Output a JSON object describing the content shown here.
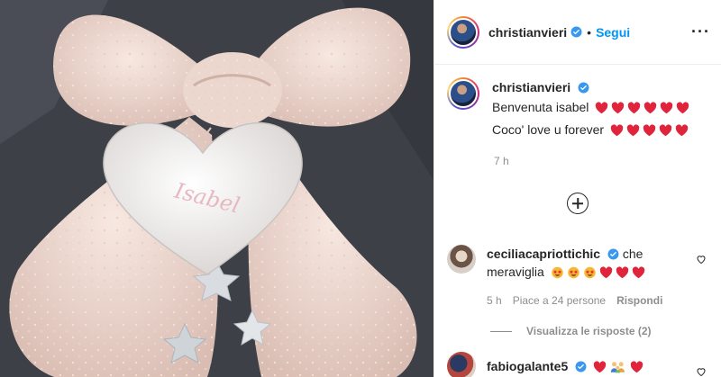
{
  "post": {
    "username": "christianvieri",
    "dot": "•",
    "follow_label": "Segui",
    "more_label": "···",
    "caption_line1": "Benvenuta isabel",
    "caption_line2": "Coco' love u forever",
    "caption_line1_hearts": 6,
    "caption_line2_hearts": 5,
    "time": "7 h"
  },
  "comments": [
    {
      "username": "ceciliacapriottichic",
      "text": "che meraviglia",
      "emojis": [
        "star-struck",
        "star-struck",
        "star-struck",
        "red-heart",
        "red-heart",
        "red-heart"
      ],
      "time": "5 h",
      "likes": "Piace a 24 persone",
      "reply_label": "Rispondi",
      "view_replies": "Visualizza le risposte (2)"
    },
    {
      "username": "fabiogalante5",
      "emojis": [
        "red-heart",
        "family",
        "red-heart"
      ]
    }
  ],
  "photo": {
    "nameplate_text": "Isabel"
  },
  "colors": {
    "accent": "#0095f6",
    "verified": "#3897f0",
    "heart": "#e0243b",
    "muted": "#8e8e8e"
  }
}
